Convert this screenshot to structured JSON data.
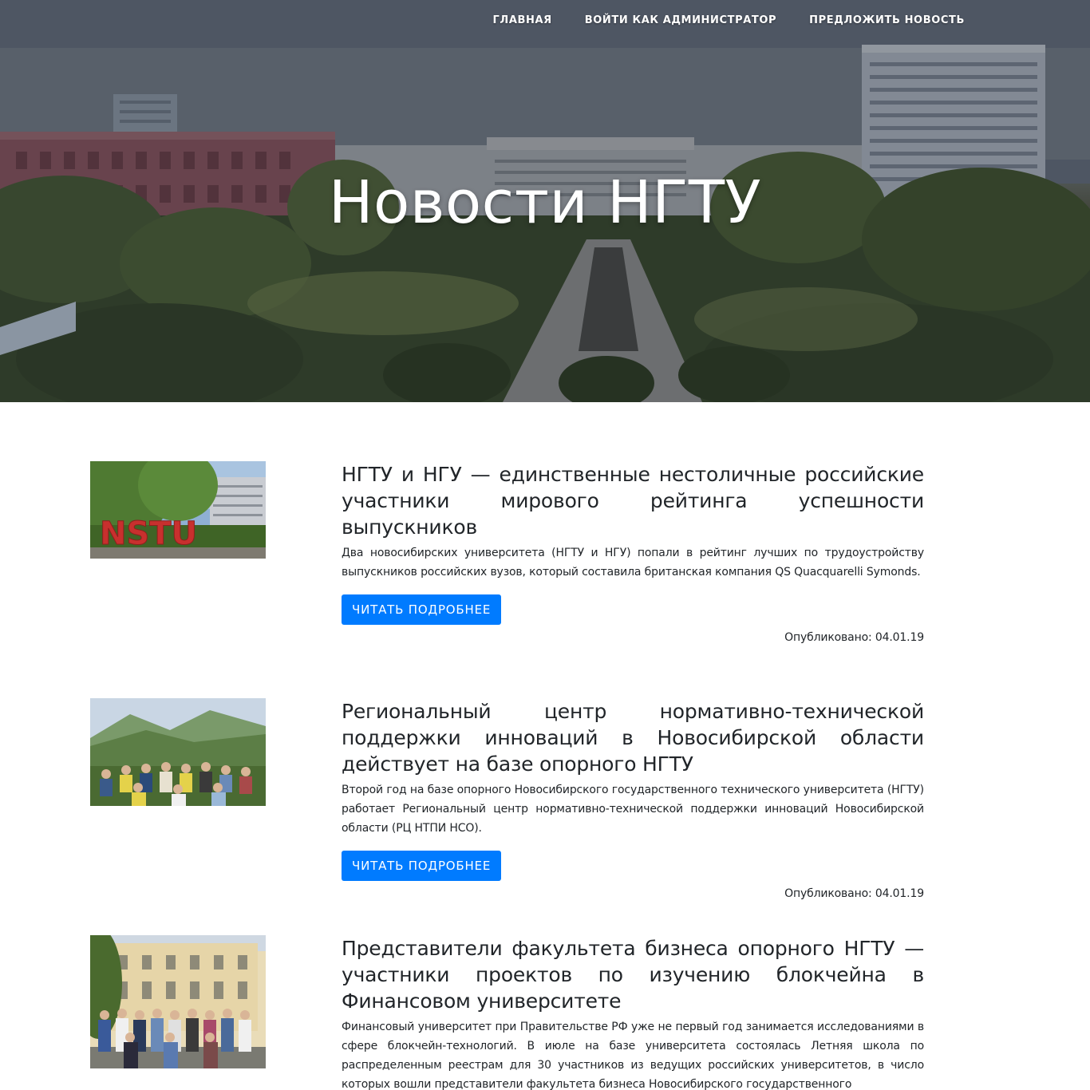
{
  "nav": {
    "items": [
      {
        "label": "ГЛАВНАЯ"
      },
      {
        "label": "ВОЙТИ КАК АДМИНИСТРАТОР"
      },
      {
        "label": "ПРЕДЛОЖИТЬ НОВОСТЬ"
      }
    ]
  },
  "hero": {
    "title": "Новости НГТУ"
  },
  "news": [
    {
      "title": "НГТУ и НГУ — единственные нестоличные российские участники мирового рейтинга успешности выпускников",
      "text": "Два новосибирских университета (НГТУ и НГУ) попали в рейтинг лучших по трудоустройству выпускников российских вузов, который составила британская компания QS Quacquarelli Symonds.",
      "button": "ЧИТАТЬ ПОДРОБНЕЕ",
      "date": "Опубликовано: 04.01.19",
      "image_label": "NSTU"
    },
    {
      "title": "Региональный центр нормативно-технической поддержки инноваций в Новосибирской области действует на базе опорного НГТУ",
      "text": "Второй год на базе опорного Новосибирского государственного технического университета (НГТУ) работает Региональный центр нормативно-технической поддержки инноваций Новосибирской области (РЦ НТПИ НСО).",
      "button": "ЧИТАТЬ ПОДРОБНЕЕ",
      "date": "Опубликовано: 04.01.19"
    },
    {
      "title": "Представители факультета бизнеса опорного НГТУ — участники проектов по изучению блокчейна в Финансовом университете",
      "text": "Финансовый университет при Правительстве РФ уже не первый год занимается исследованиями в сфере блокчейн-технологий. В июле на базе университета состоялась Летняя школа по распределенным реестрам для 30 участников из ведущих российских университетов, в число которых вошли представители факультета бизнеса Новосибирского государственного"
    }
  ],
  "colors": {
    "accent": "#007bff",
    "text": "#212529",
    "hero_text": "#ffffff"
  }
}
